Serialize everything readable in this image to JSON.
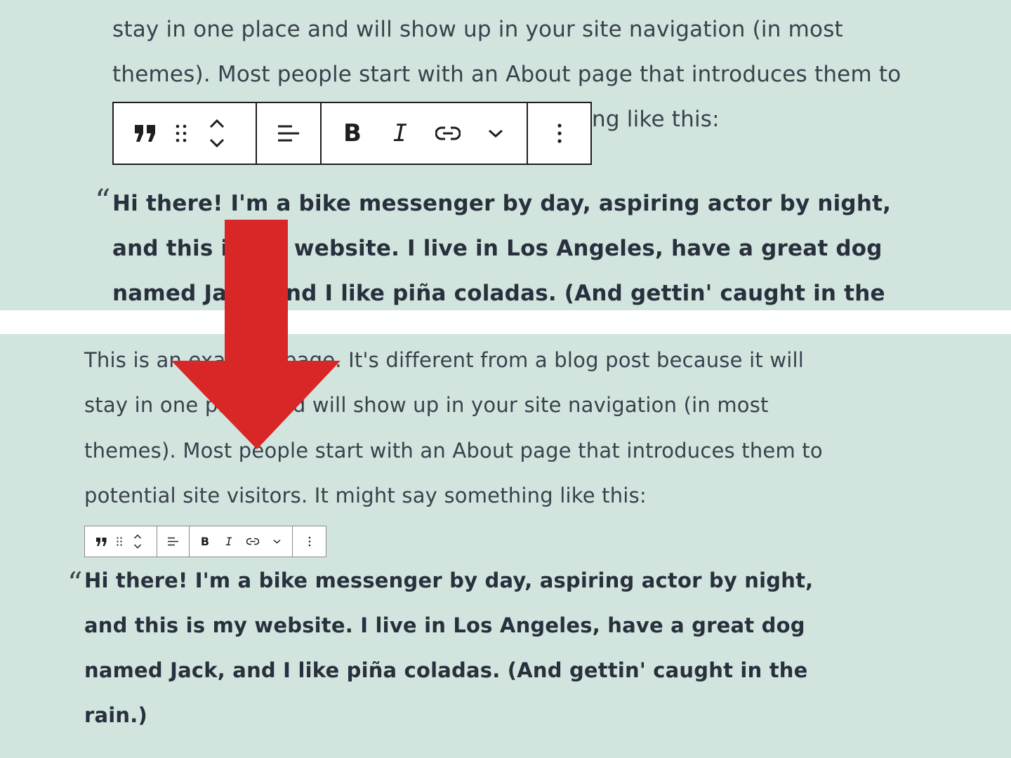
{
  "top": {
    "line1": "stay in one place and will show up in your site navigation (in most",
    "line2": "themes). Most people start with an About page that introduces them to",
    "line3_tail": "ng like this:",
    "quote_mark": "“",
    "quote": [
      "Hi there! I'm a bike messenger by day, aspiring actor by night,",
      "and this is my website. I live in Los Angeles, have a great dog",
      "named Jack, and I like piña coladas. (And gettin' caught in the"
    ]
  },
  "bottom": {
    "paragraph": [
      "This is an example page. It's different from a blog post because it will",
      "stay in one place and will show up in your site navigation (in most",
      "themes). Most people start with an About page that introduces them to",
      "potential site visitors. It might say something like this:"
    ],
    "quote_mark": "“",
    "quote": [
      "Hi there! I'm a bike messenger by day, aspiring actor by night,",
      "and this is my website. I live in Los Angeles, have a great dog",
      "named Jack, and I like piña coladas. (And gettin' caught in the",
      "rain.)"
    ]
  },
  "toolbar": {
    "bold_label": "B",
    "italic_label": "I"
  },
  "colors": {
    "background": "#d1e4dd",
    "divider": "#ffffff",
    "text": "#28303d",
    "arrow": "#d92626"
  },
  "icons": [
    "quote-block-icon",
    "drag-handle-icon",
    "move-up-icon",
    "move-down-icon",
    "align-icon",
    "link-icon",
    "chevron-down-icon",
    "more-options-icon",
    "down-arrow-icon"
  ]
}
